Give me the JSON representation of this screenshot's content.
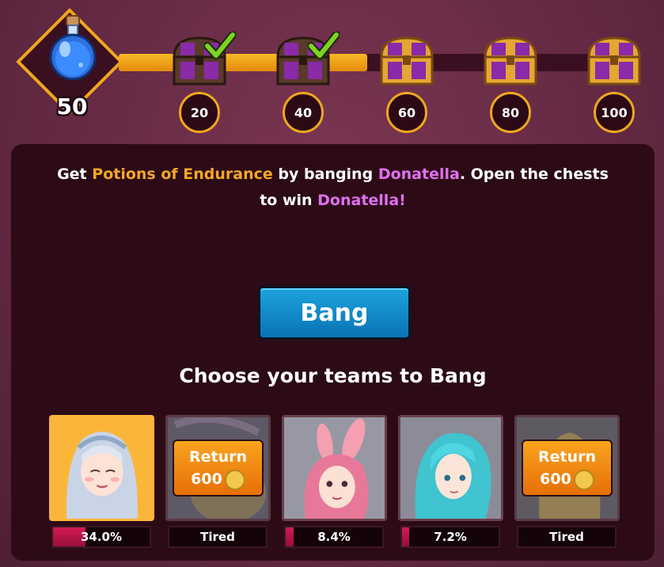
{
  "potion": {
    "icon": "blue-potion-icon",
    "count": "50"
  },
  "progress": {
    "fill_fraction": 0.49
  },
  "tiers": [
    {
      "label": "20",
      "claimed": true
    },
    {
      "label": "40",
      "claimed": true
    },
    {
      "label": "60",
      "claimed": false
    },
    {
      "label": "80",
      "claimed": false
    },
    {
      "label": "100",
      "claimed": false
    }
  ],
  "description": {
    "p1": "Get ",
    "potions": "Potions of Endurance",
    "p2": " by banging ",
    "girl": "Donatella",
    "p3": ". Open the chests",
    "p4": "to win ",
    "girl2": "Donatella!"
  },
  "bang_button": "Bang",
  "choose_text": "Choose your teams to Bang",
  "teams": [
    {
      "status": "34.0%",
      "fill": 0.34,
      "state": "active"
    },
    {
      "status": "Tired",
      "return_label": "Return",
      "cost": "600",
      "state": "tired"
    },
    {
      "status": "8.4%",
      "fill": 0.084,
      "state": "normal"
    },
    {
      "status": "7.2%",
      "fill": 0.072,
      "state": "normal"
    },
    {
      "status": "Tired",
      "return_label": "Return",
      "cost": "600",
      "state": "tired"
    }
  ],
  "colors": {
    "accent_gold": "#f0a81c",
    "bang_blue": "#1193cf",
    "return_orange": "#f28a12",
    "potion_orange": "#f4a72a",
    "girl_purple": "#e070f0"
  }
}
